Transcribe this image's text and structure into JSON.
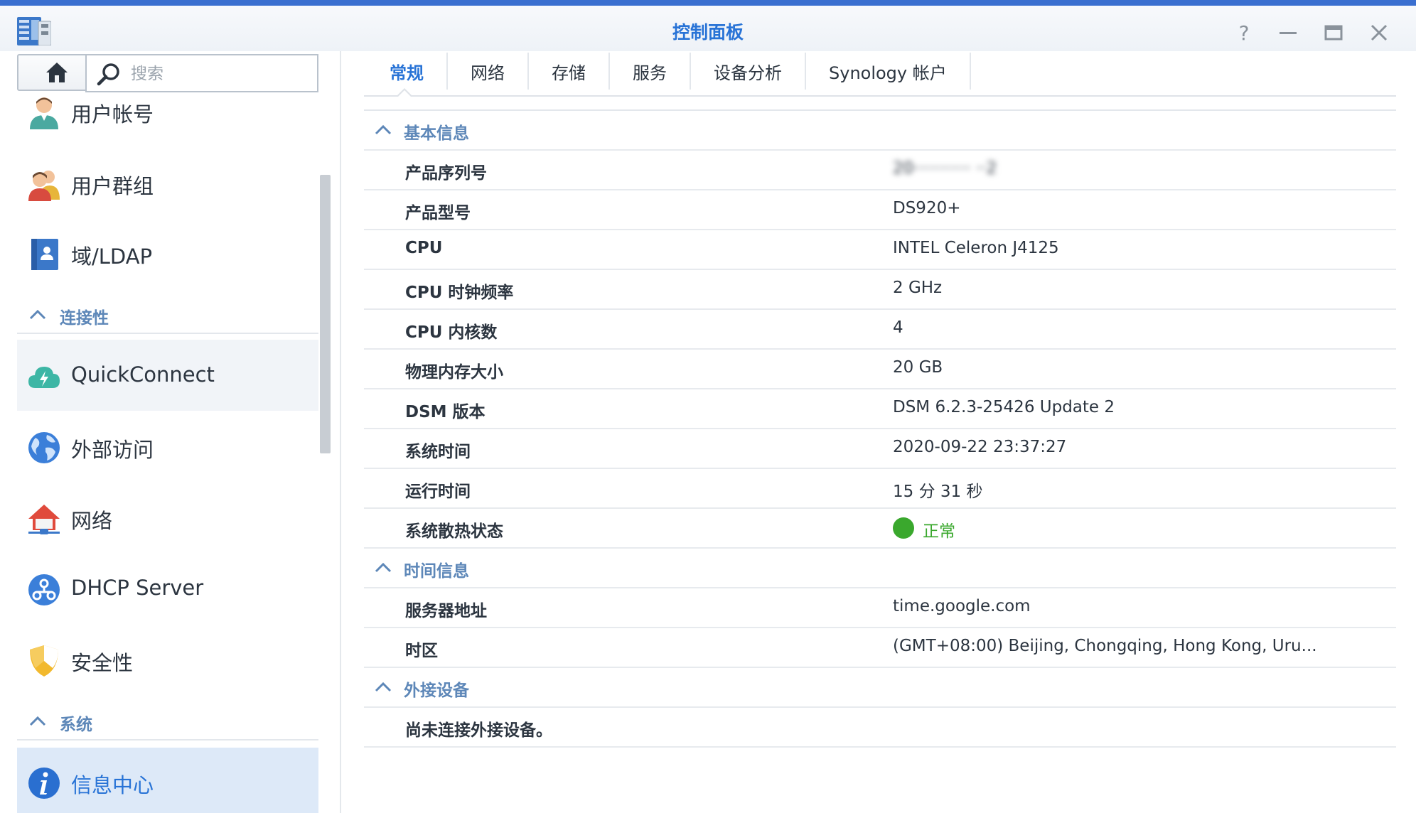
{
  "window": {
    "title": "控制面板",
    "controls": {
      "help": "?",
      "minimize": "—",
      "maximize": "▭",
      "close": "✕"
    }
  },
  "sidebar": {
    "search_placeholder": "搜索",
    "items": [
      {
        "label": "用户帐号",
        "icon": "user-icon"
      },
      {
        "label": "用户群组",
        "icon": "user-group-icon"
      },
      {
        "label": "域/LDAP",
        "icon": "ldap-icon"
      },
      {
        "label": "QuickConnect",
        "icon": "quickconnect-icon"
      },
      {
        "label": "外部访问",
        "icon": "globe-icon"
      },
      {
        "label": "网络",
        "icon": "network-house-icon"
      },
      {
        "label": "DHCP Server",
        "icon": "dhcp-icon"
      },
      {
        "label": "安全性",
        "icon": "shield-icon"
      },
      {
        "label": "信息中心",
        "icon": "info-icon"
      }
    ],
    "groups": [
      {
        "label": "连接性"
      },
      {
        "label": "系统"
      }
    ],
    "active": "信息中心"
  },
  "tabs": [
    {
      "label": "常规",
      "active": true
    },
    {
      "label": "网络"
    },
    {
      "label": "存储"
    },
    {
      "label": "服务"
    },
    {
      "label": "设备分析"
    },
    {
      "label": "Synology 帐户"
    }
  ],
  "sections": {
    "basic": {
      "title": "基本信息",
      "rows": [
        {
          "key": "产品序列号",
          "value": "20··········· ··2"
        },
        {
          "key": "产品型号",
          "value": "DS920+"
        },
        {
          "key": "CPU",
          "value": "INTEL Celeron J4125"
        },
        {
          "key": "CPU 时钟频率",
          "value": "2 GHz"
        },
        {
          "key": "CPU 内核数",
          "value": "4"
        },
        {
          "key": "物理内存大小",
          "value": "20 GB"
        },
        {
          "key": "DSM 版本",
          "value": "DSM 6.2.3-25426 Update 2"
        },
        {
          "key": "系统时间",
          "value": "2020-09-22 23:37:27"
        },
        {
          "key": "运行时间",
          "value": "15 分 31 秒"
        },
        {
          "key": "系统散热状态",
          "value": "正常",
          "status_color": "#3aa82d"
        }
      ]
    },
    "time": {
      "title": "时间信息",
      "rows": [
        {
          "key": "服务器地址",
          "value": "time.google.com"
        },
        {
          "key": "时区",
          "value": "(GMT+08:00) Beijing, Chongqing, Hong Kong, Uru..."
        }
      ]
    },
    "external": {
      "title": "外接设备",
      "empty_text": "尚未连接外接设备。"
    }
  },
  "colors": {
    "accent": "#2873d6",
    "section": "#5d87b8",
    "ok": "#3aa82d",
    "titlebar_strip": "#3a6fd0"
  }
}
